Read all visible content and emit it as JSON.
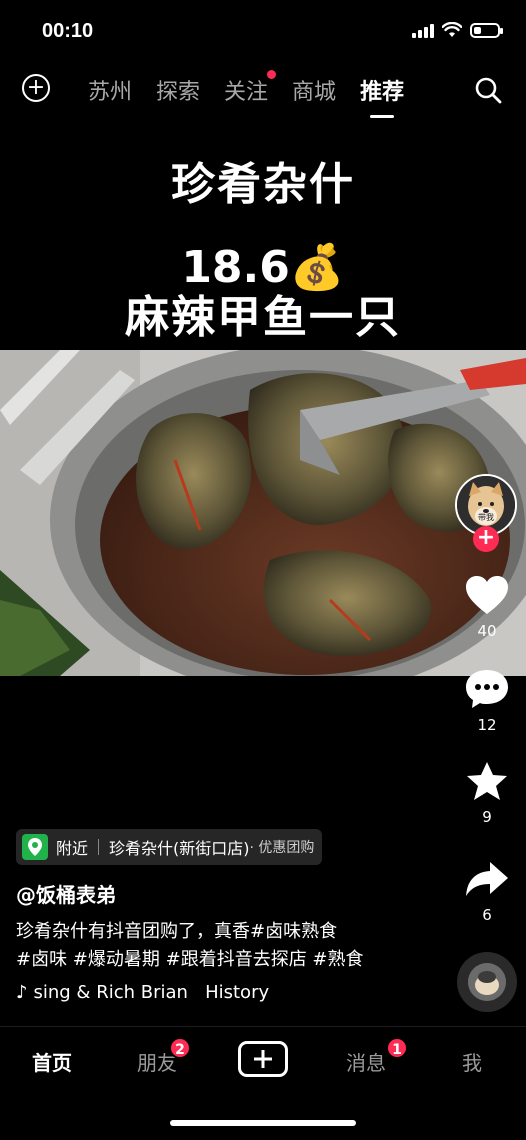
{
  "status_bar": {
    "time": "00:10",
    "battery_level": 0.3
  },
  "top_nav": {
    "tabs": [
      {
        "label": "苏州"
      },
      {
        "label": "探索"
      },
      {
        "label": "关注"
      },
      {
        "label": "商城"
      },
      {
        "label": "推荐"
      }
    ],
    "active_tab": "推荐",
    "dot_tab": "关注"
  },
  "overlay": {
    "title": "珍肴杂什",
    "price": "18.6💰",
    "dish": "麻辣甲鱼一只"
  },
  "right_rail": {
    "avatar_text": "带我",
    "likes": "40",
    "comments": "12",
    "favorites": "9",
    "shares": "6"
  },
  "location": {
    "nearby": "附近",
    "place": "珍肴杂什(新街口店)",
    "tag": "· 优惠团购"
  },
  "post": {
    "author": "@饭桶表弟",
    "caption_line1": "珍肴杂什有抖音团购了，真香#卤味熟食",
    "caption_line2": "#卤味 #爆动暑期 #跟着抖音去探店 #熟食",
    "music": "sing & Rich Brian   History"
  },
  "bottom_tabs": {
    "home": "首页",
    "friends": "朋友",
    "friends_badge": "2",
    "messages": "消息",
    "messages_badge": "1",
    "me": "我"
  },
  "colors": {
    "accent": "#fe2c55",
    "location_green": "#22b24c"
  }
}
